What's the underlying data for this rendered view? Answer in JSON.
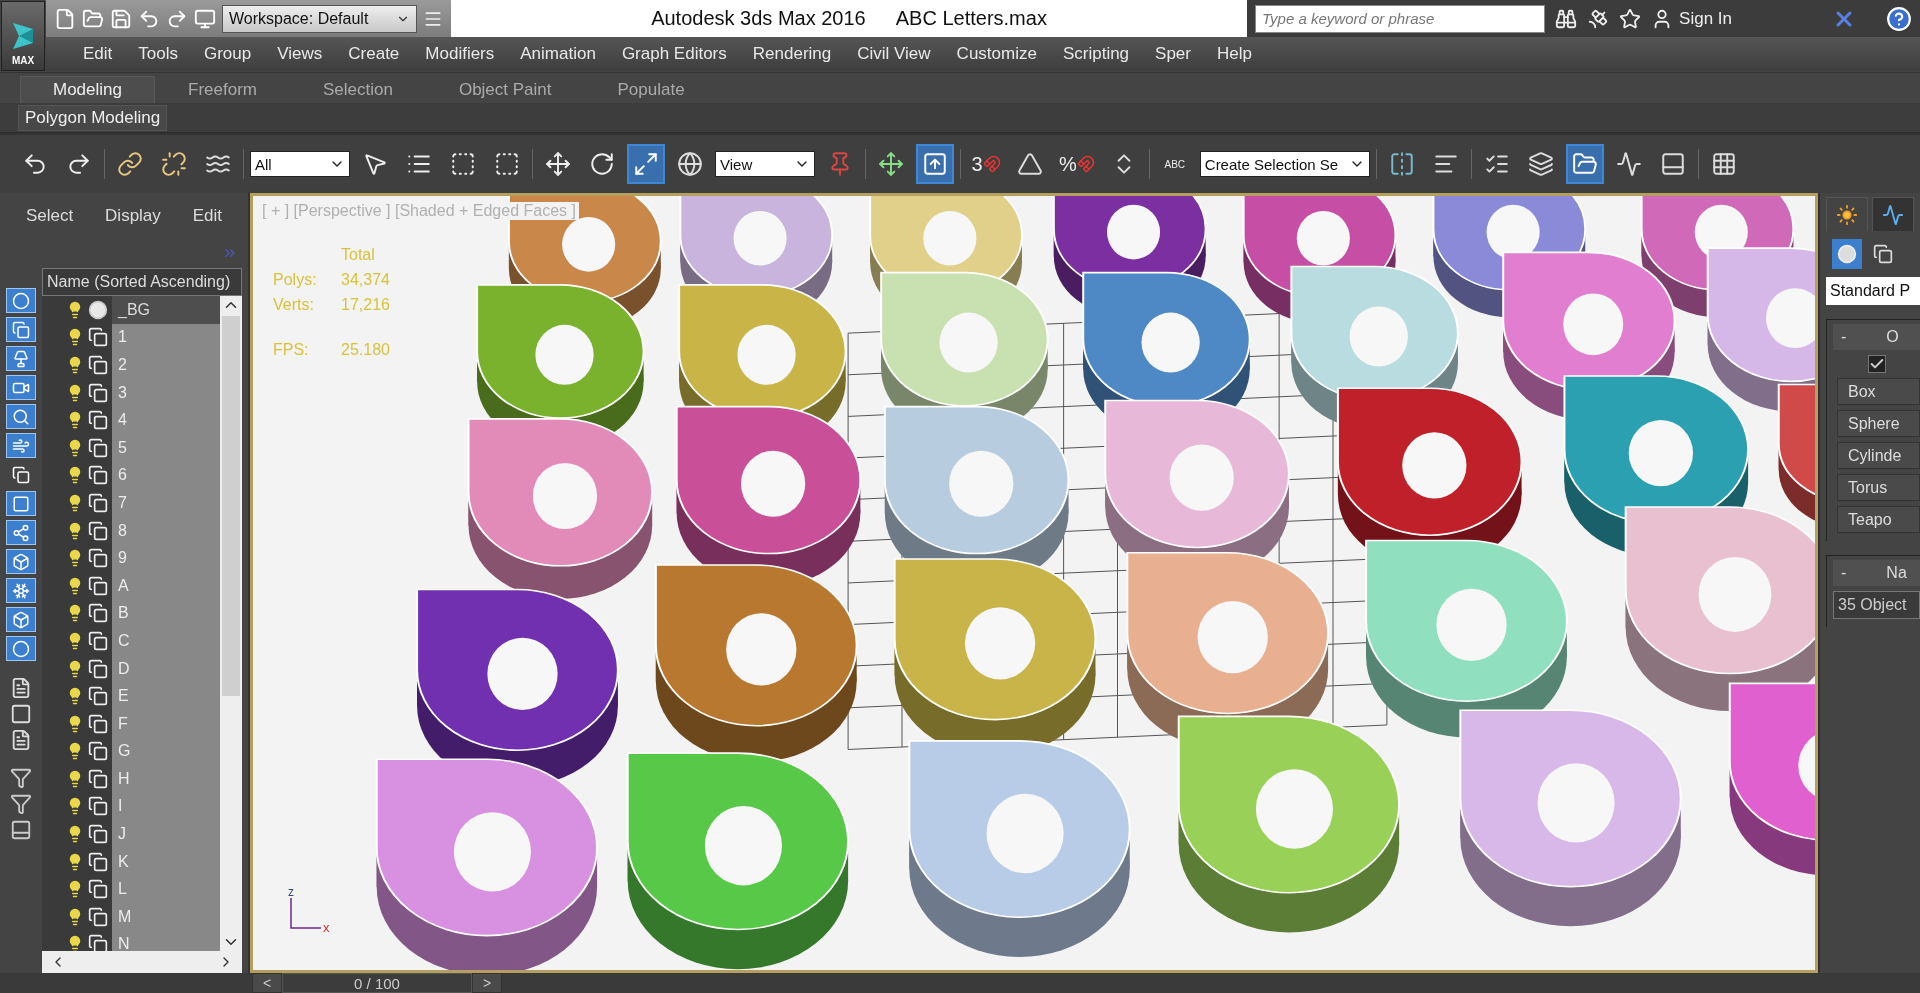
{
  "title_bar": {
    "app_button": "MAX",
    "workspace": "Workspace: Default",
    "title": "Autodesk 3ds Max 2016",
    "file_name": "ABC Letters.max",
    "search": {
      "placeholder": "Type a keyword or phrase"
    },
    "sign_in": "Sign In"
  },
  "menu": [
    "Edit",
    "Tools",
    "Group",
    "Views",
    "Create",
    "Modifiers",
    "Animation",
    "Graph Editors",
    "Rendering",
    "Civil View",
    "Customize",
    "Scripting",
    "Sper",
    "Help"
  ],
  "ribbon": {
    "tabs": [
      {
        "label": "Modeling",
        "selected": true
      },
      {
        "label": "Freeform",
        "selected": false
      },
      {
        "label": "Selection",
        "selected": false
      },
      {
        "label": "Object Paint",
        "selected": false
      },
      {
        "label": "Populate",
        "selected": false
      }
    ],
    "panel_button": "Polygon Modeling"
  },
  "main_toolbar": [
    {
      "kind": "undo",
      "on": false
    },
    {
      "kind": "redo",
      "on": false
    },
    {
      "kind": "sep"
    },
    {
      "kind": "link",
      "on": false
    },
    {
      "kind": "unlink",
      "on": false
    },
    {
      "kind": "bind",
      "on": false
    },
    {
      "kind": "sep"
    },
    {
      "kind": "dropdown",
      "value": "All"
    },
    {
      "kind": "select",
      "on": false
    },
    {
      "kind": "select-by-name",
      "on": false
    },
    {
      "kind": "region",
      "on": false
    },
    {
      "kind": "crossing",
      "on": false
    },
    {
      "kind": "sep"
    },
    {
      "kind": "move",
      "on": false
    },
    {
      "kind": "rotate",
      "on": false
    },
    {
      "kind": "scale",
      "on": true
    },
    {
      "kind": "place",
      "on": false
    },
    {
      "kind": "dropdown",
      "value": "View"
    },
    {
      "kind": "pivot",
      "on": false
    },
    {
      "kind": "sep"
    },
    {
      "kind": "manipulate",
      "on": false
    },
    {
      "kind": "shortcut",
      "on": true
    },
    {
      "kind": "sep"
    },
    {
      "kind": "snap",
      "label": "3",
      "on": false
    },
    {
      "kind": "angle-snap",
      "on": false
    },
    {
      "kind": "percent-snap",
      "label": "%",
      "on": false
    },
    {
      "kind": "spinner-snap",
      "on": false
    },
    {
      "kind": "sep"
    },
    {
      "kind": "named-sets",
      "label": "ABC",
      "on": false
    },
    {
      "kind": "dropdown",
      "value": "Create Selection Se"
    },
    {
      "kind": "sep"
    },
    {
      "kind": "mirror",
      "on": false
    },
    {
      "kind": "align",
      "on": false
    },
    {
      "kind": "sep"
    },
    {
      "kind": "layers",
      "on": false
    },
    {
      "kind": "stack",
      "on": false
    },
    {
      "kind": "explorer",
      "on": true
    },
    {
      "kind": "curve",
      "on": false
    },
    {
      "kind": "schematic",
      "on": false
    },
    {
      "kind": "sep"
    },
    {
      "kind": "material",
      "on": false
    }
  ],
  "display_filters": [
    {
      "on": true
    },
    {
      "on": true
    },
    {
      "on": true
    },
    {
      "on": true
    },
    {
      "on": true
    },
    {
      "on": true
    },
    {
      "on": false
    },
    {
      "on": true
    },
    {
      "on": true
    },
    {
      "on": true
    },
    {
      "on": true
    },
    {
      "on": true
    },
    {
      "on": true
    }
  ],
  "scene_explorer": {
    "menus": [
      "Select",
      "Display",
      "Edit"
    ],
    "column_header": "Name (Sorted Ascending)",
    "items": [
      {
        "name": "_BG",
        "kind": "sphere",
        "selected": false
      },
      {
        "name": "1",
        "kind": "group",
        "selected": true
      },
      {
        "name": "2",
        "kind": "group",
        "selected": true
      },
      {
        "name": "3",
        "kind": "group",
        "selected": true
      },
      {
        "name": "4",
        "kind": "group",
        "selected": true
      },
      {
        "name": "5",
        "kind": "group",
        "selected": true
      },
      {
        "name": "6",
        "kind": "group",
        "selected": true
      },
      {
        "name": "7",
        "kind": "group",
        "selected": true
      },
      {
        "name": "8",
        "kind": "group",
        "selected": true
      },
      {
        "name": "9",
        "kind": "group",
        "selected": true
      },
      {
        "name": "A",
        "kind": "group",
        "selected": true
      },
      {
        "name": "B",
        "kind": "group",
        "selected": true
      },
      {
        "name": "C",
        "kind": "group",
        "selected": true
      },
      {
        "name": "D",
        "kind": "group",
        "selected": true
      },
      {
        "name": "E",
        "kind": "group",
        "selected": true
      },
      {
        "name": "F",
        "kind": "group",
        "selected": true
      },
      {
        "name": "G",
        "kind": "group",
        "selected": true
      },
      {
        "name": "H",
        "kind": "group",
        "selected": true
      },
      {
        "name": "I",
        "kind": "group",
        "selected": true
      },
      {
        "name": "J",
        "kind": "group",
        "selected": true
      },
      {
        "name": "K",
        "kind": "group",
        "selected": true
      },
      {
        "name": "L",
        "kind": "group",
        "selected": true
      },
      {
        "name": "M",
        "kind": "group",
        "selected": true
      },
      {
        "name": "N",
        "kind": "group",
        "selected": true
      }
    ]
  },
  "viewport": {
    "label": "[ + ] [Perspective ] [Shaded + Edged Faces ]",
    "stats_header": "Total",
    "stats": [
      {
        "label": "Polys:",
        "value": "34,374"
      },
      {
        "label": "Verts:",
        "value": "17,216"
      },
      {
        "label": "FPS:",
        "value": "25.180"
      }
    ],
    "axis": [
      "z",
      "x"
    ]
  },
  "command_panel": {
    "tabs": [
      {
        "selected": true
      },
      {
        "selected": false
      }
    ],
    "categories": [
      {
        "on": true
      },
      {
        "on": false
      }
    ],
    "category_dropdown": "Standard P",
    "rollouts": [
      {
        "toggle": "-",
        "title": "O"
      },
      {
        "toggle": "-",
        "title": "Na"
      }
    ],
    "autogrid_checked": true,
    "buttons": [
      "Box",
      "Sphere",
      "Cylinde",
      "Torus",
      "Teapo"
    ],
    "name_field": "35 Object"
  },
  "timeline": {
    "prev": "<",
    "frame": "0 / 100",
    "next": ">",
    "level": 0
  }
}
